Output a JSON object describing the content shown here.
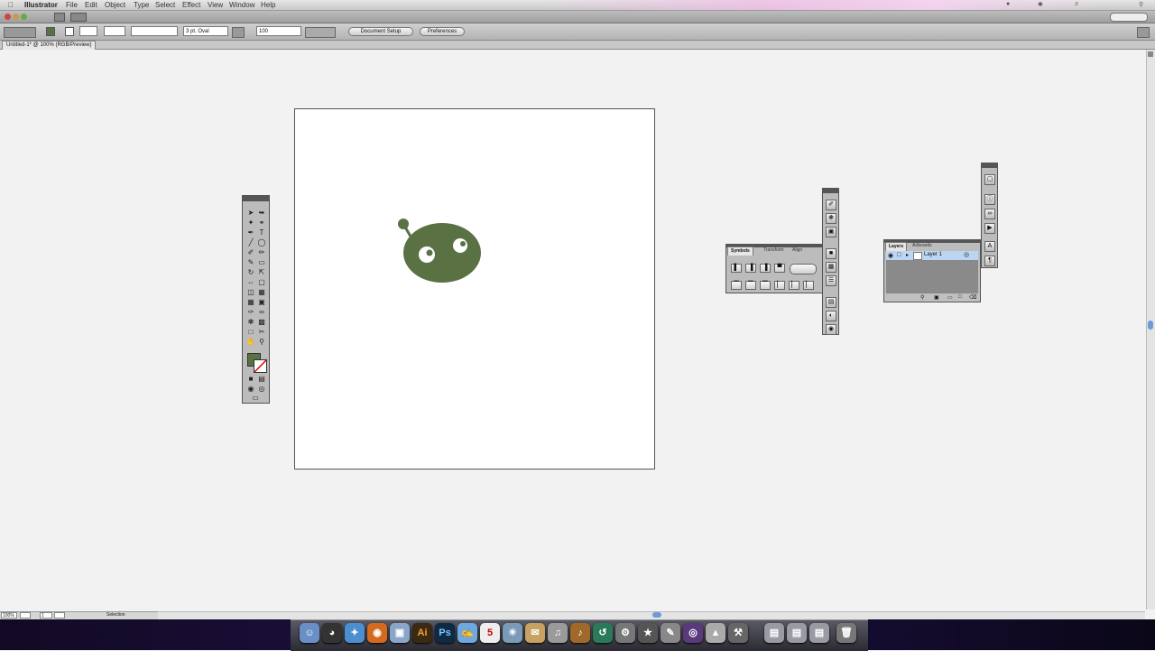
{
  "menubar": {
    "app": "Illustrator",
    "items": [
      "File",
      "Edit",
      "Object",
      "Type",
      "Select",
      "Effect",
      "View",
      "Window",
      "Help"
    ]
  },
  "control_bar": {
    "stroke_style": "3 pt. Oval",
    "opacity": "100",
    "document_setup_label": "Document Setup",
    "preferences_label": "Preferences"
  },
  "document": {
    "tab_title": "Untitled-1* @ 100% (RGB/Preview)"
  },
  "status_bar": {
    "zoom": "100%",
    "page": "1",
    "mode": "Selection"
  },
  "panels": {
    "swatch_panel": {
      "tabs": [
        "Symbols",
        "Transform",
        "Align"
      ]
    },
    "layers_panel": {
      "tabs": [
        "Layers",
        "Artboards"
      ],
      "layer_name": "Layer 1"
    }
  },
  "colors": {
    "character_fill": "#5a7143",
    "fill_swatch": "#5a7143",
    "canvas_bg": "#f2f2f2"
  },
  "dock": {
    "icons": [
      "finder-icon",
      "dashboard-icon",
      "safari-icon",
      "firefox-icon",
      "preview-icon",
      "illustrator-icon",
      "photoshop-icon",
      "ichat-icon",
      "ical-icon",
      "iphoto-icon",
      "mail-icon",
      "itunes-icon",
      "garageband-icon",
      "time-machine-icon",
      "system-prefs-icon",
      "imovie-icon",
      "iwork-icon",
      "idvd-icon",
      "app-store-icon",
      "tools-icon",
      "folder-icon",
      "folder-icon",
      "folder-icon",
      "trash-icon"
    ]
  }
}
